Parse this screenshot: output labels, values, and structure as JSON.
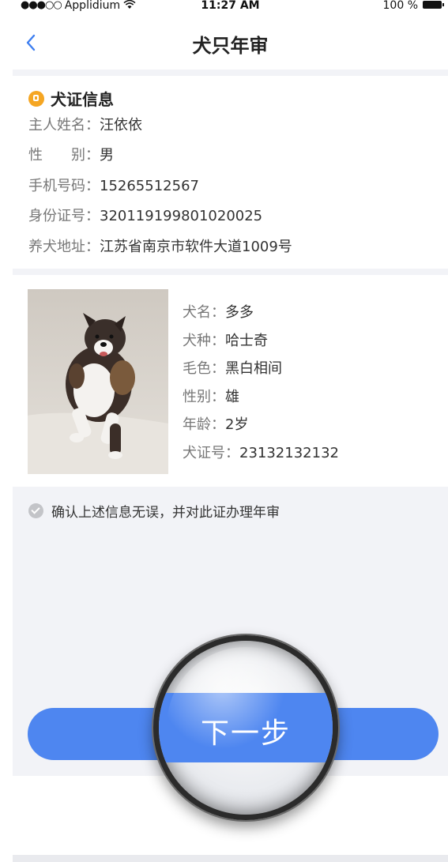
{
  "status_bar": {
    "signal": "●●●○○",
    "carrier": "Applidium",
    "time": "11:27 AM",
    "battery": "100 %"
  },
  "nav": {
    "title": "犬只年审"
  },
  "owner": {
    "section_title": "犬证信息",
    "rows": [
      {
        "label": "主人姓名：",
        "value": "汪依依"
      },
      {
        "label": "性　　别：",
        "value": "男"
      },
      {
        "label": "手机号码：",
        "value": "15265512567"
      },
      {
        "label": "身份证号：",
        "value": "320119199801020025"
      },
      {
        "label": "养犬地址：",
        "value": "江苏省南京市软件大道1009号"
      }
    ]
  },
  "dog": {
    "rows": [
      {
        "label": "犬名：",
        "value": "多多"
      },
      {
        "label": "犬种：",
        "value": "哈士奇"
      },
      {
        "label": "毛色：",
        "value": "黑白相间"
      },
      {
        "label": "性别：",
        "value": "雄"
      },
      {
        "label": "年龄：",
        "value": "2岁"
      },
      {
        "label": "犬证号：",
        "value": "23132132132"
      }
    ]
  },
  "confirm": {
    "text": "确认上述信息无误，并对此证办理年审"
  },
  "next_button": {
    "label": "下一步"
  },
  "colors": {
    "accent": "#4e86f0",
    "background": "#f2f3f7",
    "badge": "#f5a623"
  }
}
